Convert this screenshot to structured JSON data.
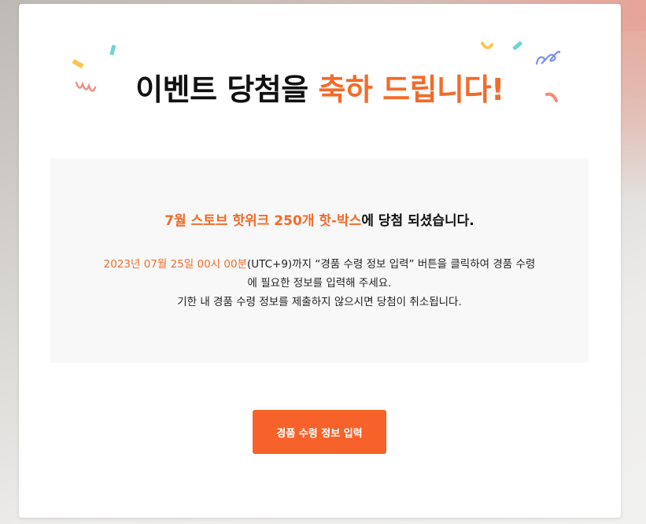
{
  "header": {
    "title_main": "이벤트 당첨을 ",
    "title_accent": "축하 드립니다!"
  },
  "notice": {
    "prize_name": "7월 스토브 핫위크 250개 핫-박스",
    "prize_suffix": "에 당첨 되셨습니다.",
    "deadline": "2023년 07월 25일 00시 00분",
    "line1_rest": "(UTC+9)까지 “경품 수령 정보 입력” 버튼을 클릭하여 경품 수령",
    "line2": "에 필요한 정보를 입력해 주세요.",
    "line3": "기한 내 경품 수령 정보를 제출하지 않으시면 당첨이 취소됩니다."
  },
  "actions": {
    "submit_label": "경품 수령 정보 입력"
  },
  "colors": {
    "accent": "#f26b2a",
    "button": "#f7622a",
    "confetti_yellow": "#f9c652",
    "confetti_teal": "#6fd3d6",
    "confetti_pink": "#f08c7a",
    "confetti_blue": "#7d8ff0"
  }
}
